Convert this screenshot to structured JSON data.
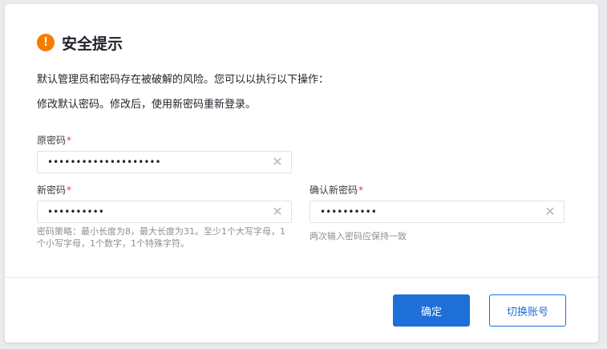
{
  "dialog": {
    "title": "安全提示",
    "icon": "warning-icon",
    "description_line1": "默认管理员和密码存在被破解的风险。您可以以执行以下操作：",
    "description_line2": "修改默认密码。修改后，使用新密码重新登录。"
  },
  "form": {
    "old_password": {
      "label": "原密码",
      "required_mark": "*",
      "value": "••••••••••••••••••••"
    },
    "new_password": {
      "label": "新密码",
      "required_mark": "*",
      "value": "••••••••••",
      "hint": "密码策略：最小长度为8，最大长度为31。至少1个大写字母，1个小写字母，1个数字，1个特殊字符。"
    },
    "confirm_password": {
      "label": "确认新密码",
      "required_mark": "*",
      "value": "••••••••••",
      "hint": "两次输入密码应保持一致"
    },
    "clear_symbol": "✕"
  },
  "actions": {
    "confirm_label": "确定",
    "switch_account_label": "切换账号"
  },
  "colors": {
    "accent": "#1f6fd9",
    "warning": "#f57c00",
    "required": "#e53935"
  }
}
